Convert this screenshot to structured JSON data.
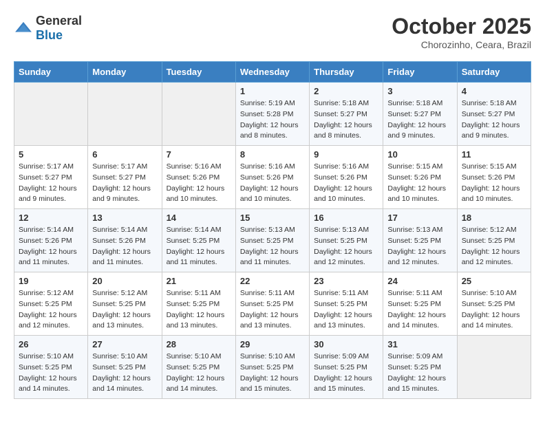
{
  "header": {
    "logo_general": "General",
    "logo_blue": "Blue",
    "month_year": "October 2025",
    "location": "Chorozinho, Ceara, Brazil"
  },
  "days_of_week": [
    "Sunday",
    "Monday",
    "Tuesday",
    "Wednesday",
    "Thursday",
    "Friday",
    "Saturday"
  ],
  "weeks": [
    [
      {
        "day": "",
        "info": ""
      },
      {
        "day": "",
        "info": ""
      },
      {
        "day": "",
        "info": ""
      },
      {
        "day": "1",
        "sunrise": "Sunrise: 5:19 AM",
        "sunset": "Sunset: 5:28 PM",
        "daylight": "Daylight: 12 hours and 8 minutes."
      },
      {
        "day": "2",
        "sunrise": "Sunrise: 5:18 AM",
        "sunset": "Sunset: 5:27 PM",
        "daylight": "Daylight: 12 hours and 8 minutes."
      },
      {
        "day": "3",
        "sunrise": "Sunrise: 5:18 AM",
        "sunset": "Sunset: 5:27 PM",
        "daylight": "Daylight: 12 hours and 9 minutes."
      },
      {
        "day": "4",
        "sunrise": "Sunrise: 5:18 AM",
        "sunset": "Sunset: 5:27 PM",
        "daylight": "Daylight: 12 hours and 9 minutes."
      }
    ],
    [
      {
        "day": "5",
        "sunrise": "Sunrise: 5:17 AM",
        "sunset": "Sunset: 5:27 PM",
        "daylight": "Daylight: 12 hours and 9 minutes."
      },
      {
        "day": "6",
        "sunrise": "Sunrise: 5:17 AM",
        "sunset": "Sunset: 5:27 PM",
        "daylight": "Daylight: 12 hours and 9 minutes."
      },
      {
        "day": "7",
        "sunrise": "Sunrise: 5:16 AM",
        "sunset": "Sunset: 5:26 PM",
        "daylight": "Daylight: 12 hours and 10 minutes."
      },
      {
        "day": "8",
        "sunrise": "Sunrise: 5:16 AM",
        "sunset": "Sunset: 5:26 PM",
        "daylight": "Daylight: 12 hours and 10 minutes."
      },
      {
        "day": "9",
        "sunrise": "Sunrise: 5:16 AM",
        "sunset": "Sunset: 5:26 PM",
        "daylight": "Daylight: 12 hours and 10 minutes."
      },
      {
        "day": "10",
        "sunrise": "Sunrise: 5:15 AM",
        "sunset": "Sunset: 5:26 PM",
        "daylight": "Daylight: 12 hours and 10 minutes."
      },
      {
        "day": "11",
        "sunrise": "Sunrise: 5:15 AM",
        "sunset": "Sunset: 5:26 PM",
        "daylight": "Daylight: 12 hours and 10 minutes."
      }
    ],
    [
      {
        "day": "12",
        "sunrise": "Sunrise: 5:14 AM",
        "sunset": "Sunset: 5:26 PM",
        "daylight": "Daylight: 12 hours and 11 minutes."
      },
      {
        "day": "13",
        "sunrise": "Sunrise: 5:14 AM",
        "sunset": "Sunset: 5:26 PM",
        "daylight": "Daylight: 12 hours and 11 minutes."
      },
      {
        "day": "14",
        "sunrise": "Sunrise: 5:14 AM",
        "sunset": "Sunset: 5:25 PM",
        "daylight": "Daylight: 12 hours and 11 minutes."
      },
      {
        "day": "15",
        "sunrise": "Sunrise: 5:13 AM",
        "sunset": "Sunset: 5:25 PM",
        "daylight": "Daylight: 12 hours and 11 minutes."
      },
      {
        "day": "16",
        "sunrise": "Sunrise: 5:13 AM",
        "sunset": "Sunset: 5:25 PM",
        "daylight": "Daylight: 12 hours and 12 minutes."
      },
      {
        "day": "17",
        "sunrise": "Sunrise: 5:13 AM",
        "sunset": "Sunset: 5:25 PM",
        "daylight": "Daylight: 12 hours and 12 minutes."
      },
      {
        "day": "18",
        "sunrise": "Sunrise: 5:12 AM",
        "sunset": "Sunset: 5:25 PM",
        "daylight": "Daylight: 12 hours and 12 minutes."
      }
    ],
    [
      {
        "day": "19",
        "sunrise": "Sunrise: 5:12 AM",
        "sunset": "Sunset: 5:25 PM",
        "daylight": "Daylight: 12 hours and 12 minutes."
      },
      {
        "day": "20",
        "sunrise": "Sunrise: 5:12 AM",
        "sunset": "Sunset: 5:25 PM",
        "daylight": "Daylight: 12 hours and 13 minutes."
      },
      {
        "day": "21",
        "sunrise": "Sunrise: 5:11 AM",
        "sunset": "Sunset: 5:25 PM",
        "daylight": "Daylight: 12 hours and 13 minutes."
      },
      {
        "day": "22",
        "sunrise": "Sunrise: 5:11 AM",
        "sunset": "Sunset: 5:25 PM",
        "daylight": "Daylight: 12 hours and 13 minutes."
      },
      {
        "day": "23",
        "sunrise": "Sunrise: 5:11 AM",
        "sunset": "Sunset: 5:25 PM",
        "daylight": "Daylight: 12 hours and 13 minutes."
      },
      {
        "day": "24",
        "sunrise": "Sunrise: 5:11 AM",
        "sunset": "Sunset: 5:25 PM",
        "daylight": "Daylight: 12 hours and 14 minutes."
      },
      {
        "day": "25",
        "sunrise": "Sunrise: 5:10 AM",
        "sunset": "Sunset: 5:25 PM",
        "daylight": "Daylight: 12 hours and 14 minutes."
      }
    ],
    [
      {
        "day": "26",
        "sunrise": "Sunrise: 5:10 AM",
        "sunset": "Sunset: 5:25 PM",
        "daylight": "Daylight: 12 hours and 14 minutes."
      },
      {
        "day": "27",
        "sunrise": "Sunrise: 5:10 AM",
        "sunset": "Sunset: 5:25 PM",
        "daylight": "Daylight: 12 hours and 14 minutes."
      },
      {
        "day": "28",
        "sunrise": "Sunrise: 5:10 AM",
        "sunset": "Sunset: 5:25 PM",
        "daylight": "Daylight: 12 hours and 14 minutes."
      },
      {
        "day": "29",
        "sunrise": "Sunrise: 5:10 AM",
        "sunset": "Sunset: 5:25 PM",
        "daylight": "Daylight: 12 hours and 15 minutes."
      },
      {
        "day": "30",
        "sunrise": "Sunrise: 5:09 AM",
        "sunset": "Sunset: 5:25 PM",
        "daylight": "Daylight: 12 hours and 15 minutes."
      },
      {
        "day": "31",
        "sunrise": "Sunrise: 5:09 AM",
        "sunset": "Sunset: 5:25 PM",
        "daylight": "Daylight: 12 hours and 15 minutes."
      },
      {
        "day": "",
        "info": ""
      }
    ]
  ]
}
